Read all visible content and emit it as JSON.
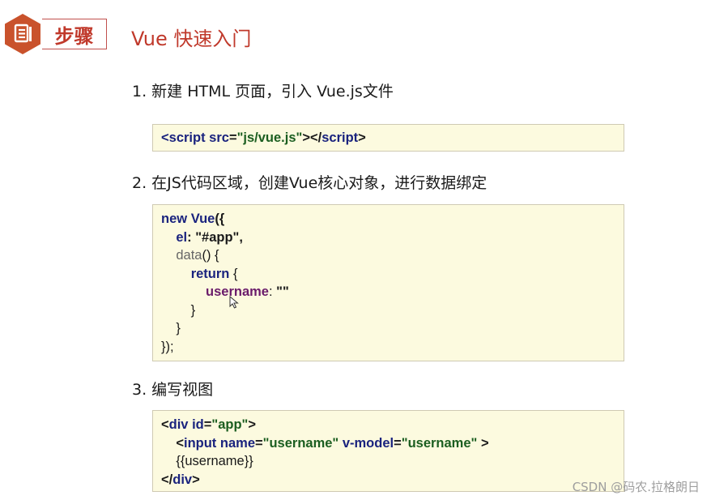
{
  "header": {
    "icon": "document-icon",
    "step_label": "步骤",
    "title": "Vue 快速入门"
  },
  "steps": [
    {
      "label": "1. 新建 HTML 页面，引入 Vue.js文件",
      "code": {
        "l1": {
          "a": "<",
          "b": "script",
          "c": " src",
          "d": "=",
          "e": "\"js/vue.js\"",
          "f": "></",
          "g": "script",
          "h": ">"
        }
      }
    },
    {
      "label": "2. 在JS代码区域，创建Vue核心对象，进行数据绑定",
      "code": {
        "l1": {
          "a": "new ",
          "b": "Vue",
          "c": "({"
        },
        "l2": {
          "a": "    ",
          "b": "el",
          "c": ": ",
          "d": "\"#app\"",
          "e": ","
        },
        "l3": {
          "a": "    ",
          "b": "data",
          "c": "() {"
        },
        "l4": {
          "a": "        ",
          "b": "return",
          "c": " {"
        },
        "l5": {
          "a": "            ",
          "b": "username",
          "c": ": ",
          "d": "\"\""
        },
        "l6": {
          "a": "        }"
        },
        "l7": {
          "a": "    }"
        },
        "l8": {
          "a": "});"
        }
      }
    },
    {
      "label": "3. 编写视图",
      "code": {
        "l1": {
          "a": "<",
          "b": "div",
          "c": " id",
          "d": "=",
          "e": "\"app\"",
          "f": ">"
        },
        "l2": {
          "a": "    <",
          "b": "input",
          "c": " name",
          "d": "=",
          "e": "\"username\"",
          "f": " v-model",
          "g": "=",
          "h": "\"username\"",
          "i": " >"
        },
        "l3": {
          "a": "    {{username}}"
        },
        "l4": {
          "a": "</",
          "b": "div",
          "c": ">"
        }
      }
    }
  ],
  "watermark": "CSDN @码农.拉格朗日",
  "colors": {
    "accent": "#c0392b",
    "code_bg": "#fcfadf",
    "keyword": "#1a237e",
    "string": "#1b5e20",
    "property": "#6a1b6a"
  }
}
